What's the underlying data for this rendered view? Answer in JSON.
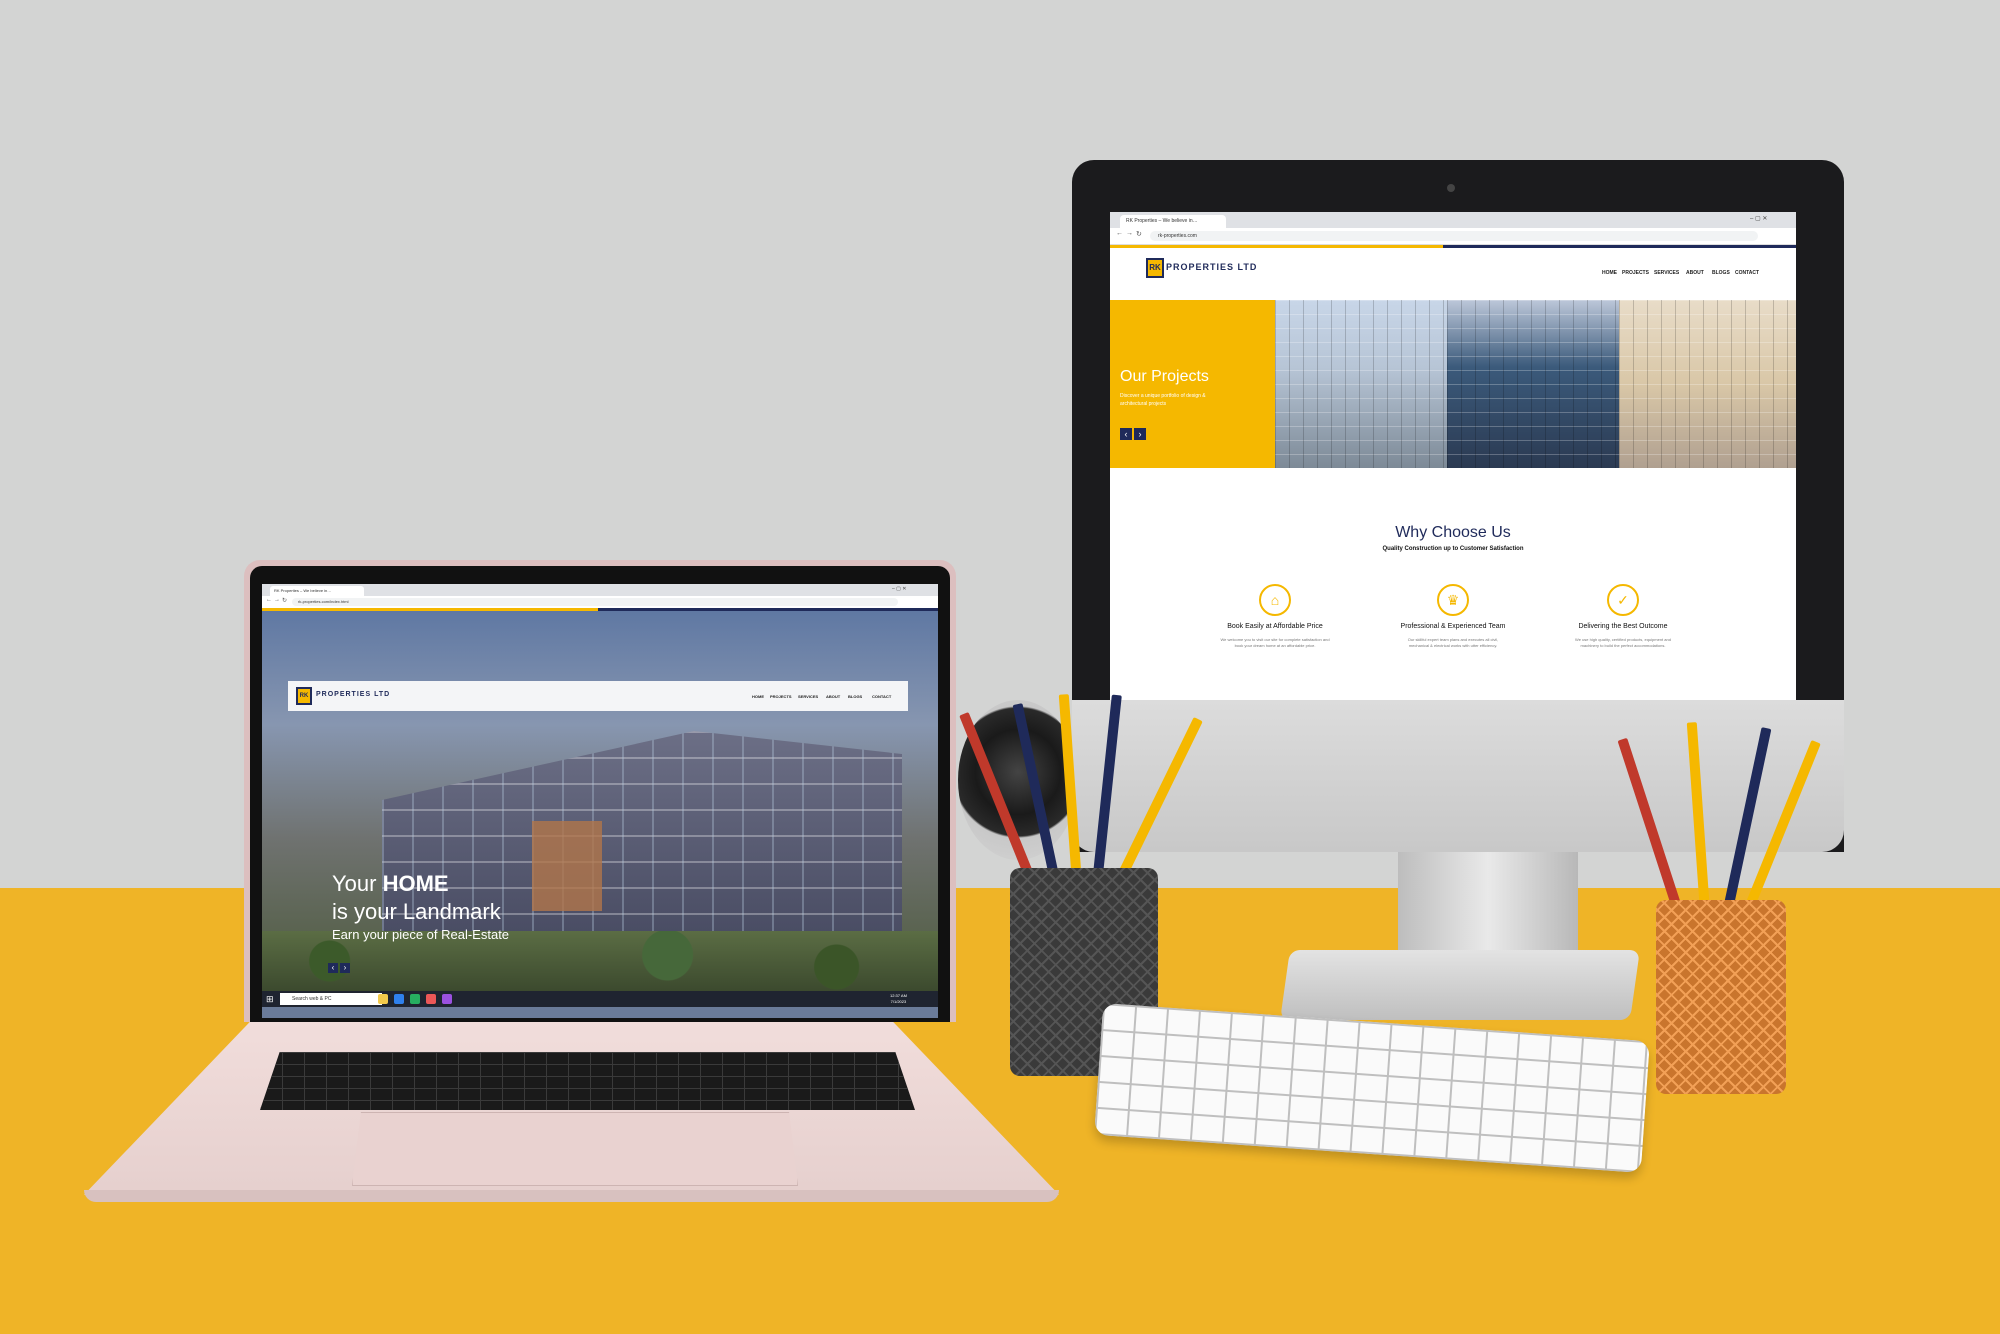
{
  "imac": {
    "tab_title": "RK Properties – We believe in…",
    "url": "rk-properties.com",
    "site": {
      "logo_mark": "RK",
      "logo_text": "PROPERTIES LTD",
      "nav": [
        "HOME",
        "PROJECTS",
        "SERVICES",
        "ABOUT",
        "BLOGS",
        "CONTACT"
      ]
    },
    "projects": {
      "title": "Our Projects",
      "subtitle": "Discover a unique portfolio of design & architectural projects",
      "prev": "‹",
      "next": "›"
    },
    "why": {
      "title": "Why Choose Us",
      "subtitle": "Quality Construction up to Customer Satisfaction",
      "features": [
        {
          "icon": "hand-house-icon",
          "glyph": "⌂",
          "title": "Book Easily at Affordable Price",
          "desc": "We welcome you to visit our site for complete satisfaction and book your dream home at an affordable price."
        },
        {
          "icon": "trophy-icon",
          "glyph": "♛",
          "title": "Professional & Experienced Team",
          "desc": "Our skillful expert team plans and executes all civil, mechanical & electrical works with utter efficiency."
        },
        {
          "icon": "check-badge-icon",
          "glyph": "✓",
          "title": "Delivering the Best Outcome",
          "desc": "We use high quality, certified products, equipment and machinery to build the perfect accommodations."
        }
      ]
    },
    "apple_logo": ""
  },
  "laptop": {
    "tab_title": "RK Properties – We believe in…",
    "url": "rk-properties.com/index.html",
    "site": {
      "logo_mark": "RK",
      "logo_text": "PROPERTIES LTD",
      "nav": [
        "HOME",
        "PROJECTS",
        "SERVICES",
        "ABOUT",
        "BLOGS",
        "CONTACT"
      ]
    },
    "hero": {
      "line1_prefix": "Your ",
      "line1_strong": "HOME",
      "line2": "is your Landmark",
      "line3": "Earn your piece of Real-Estate",
      "prev": "‹",
      "next": "›"
    },
    "taskbar": {
      "search_placeholder": "Search web & PC",
      "time": "12:37 AM",
      "date": "7/1/2023"
    }
  },
  "colors": {
    "brand_yellow": "#f5b800",
    "brand_navy": "#1f2a5a",
    "desk": "#efb427",
    "wall": "#d3d4d3"
  }
}
